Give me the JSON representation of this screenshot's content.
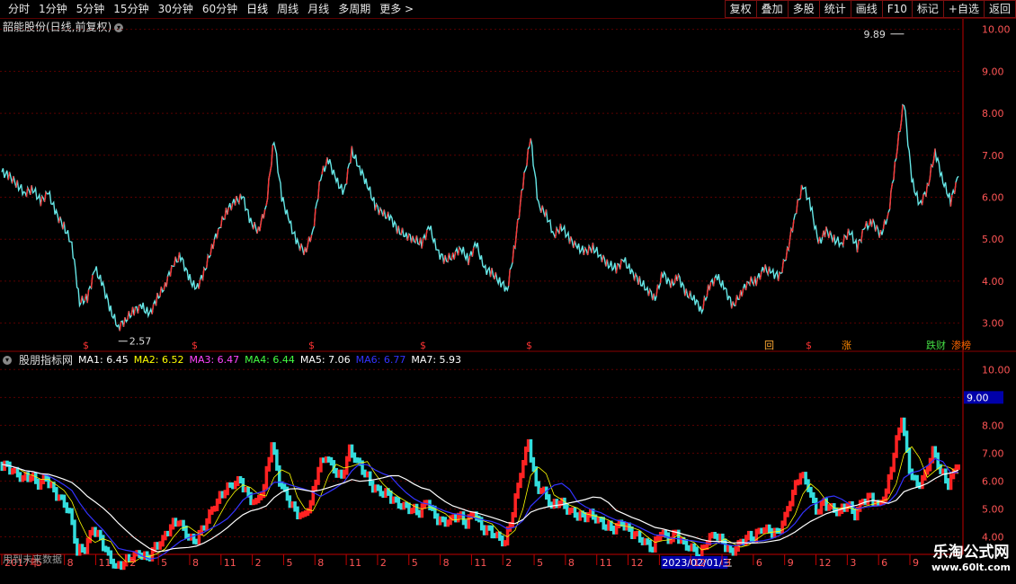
{
  "toolbar": {
    "left": [
      "分时",
      "1分钟",
      "5分钟",
      "15分钟",
      "30分钟",
      "60分钟",
      "日线",
      "周线",
      "月线",
      "多周期",
      "更多 >"
    ],
    "active": "日线",
    "right": [
      "复权",
      "叠加",
      "多股",
      "统计",
      "画线",
      "F10",
      "标记",
      "+自选",
      "返回"
    ]
  },
  "main_title": "韶能股份(日线,前复权)",
  "indicator": {
    "name": "股朋指标网",
    "ma": [
      {
        "label": "MA1:",
        "value": "6.45",
        "color": "#ffffff"
      },
      {
        "label": "MA2:",
        "value": "6.52",
        "color": "#ffff00"
      },
      {
        "label": "MA3:",
        "value": "6.47",
        "color": "#ff44ff"
      },
      {
        "label": "MA4:",
        "value": "6.44",
        "color": "#44ff44"
      },
      {
        "label": "MA5:",
        "value": "7.06",
        "color": "#ffffff"
      },
      {
        "label": "MA6:",
        "value": "6.77",
        "color": "#3333ff"
      },
      {
        "label": "MA7:",
        "value": "5.93",
        "color": "#ffffff"
      }
    ],
    "current_price_tag": "9.00",
    "future_note": "用到未来数据"
  },
  "chart_data": [
    {
      "type": "line",
      "title": "韶能股份(日线,前复权)",
      "y_ticks": [
        "3.00",
        "4.00",
        "5.00",
        "6.00",
        "7.00",
        "8.00",
        "9.00",
        "10.00"
      ],
      "ylim": [
        2.5,
        10.1
      ],
      "annotations": [
        {
          "text": "9.89",
          "value": 9.89
        },
        {
          "text": "2.57",
          "value": 2.57
        }
      ],
      "signal_markers": [
        "$",
        "$",
        "$",
        "$",
        "$",
        "回",
        "$",
        "涨",
        "跌财",
        "渗榜"
      ],
      "series": [
        {
          "values": [
            6.6,
            6.5,
            6.3,
            6.1,
            6.2,
            5.9,
            6.1,
            5.6,
            5.3,
            4.9,
            3.5,
            3.6,
            4.3,
            3.9,
            3.3,
            2.9,
            3.1,
            3.3,
            3.4,
            3.2,
            3.6,
            3.9,
            4.4,
            4.6,
            4.1,
            3.8,
            4.2,
            4.8,
            5.3,
            5.7,
            5.9,
            6.0,
            5.4,
            5.2,
            5.8,
            7.4,
            6.0,
            5.4,
            4.9,
            4.7,
            5.2,
            6.5,
            6.9,
            6.4,
            6.1,
            7.1,
            6.7,
            6.3,
            5.8,
            5.6,
            5.5,
            5.2,
            5.1,
            5.0,
            4.9,
            5.3,
            4.7,
            4.5,
            4.6,
            4.8,
            4.5,
            4.9,
            4.3,
            4.2,
            4.0,
            3.8,
            4.9,
            6.3,
            7.4,
            5.8,
            5.6,
            5.1,
            5.3,
            5.0,
            4.8,
            4.7,
            4.8,
            4.6,
            4.4,
            4.3,
            4.5,
            4.2,
            4.0,
            3.8,
            3.6,
            4.2,
            3.9,
            4.1,
            3.7,
            3.6,
            3.3,
            3.9,
            4.1,
            3.8,
            3.4,
            3.7,
            4.0,
            4.0,
            4.3,
            4.2,
            4.1,
            4.7,
            5.6,
            6.3,
            5.8,
            4.9,
            5.2,
            5.0,
            4.9,
            5.2,
            4.8,
            5.3,
            5.4,
            5.1,
            5.6,
            7.0,
            8.3,
            6.4,
            5.8,
            6.2,
            7.1,
            6.4,
            5.9,
            6.5
          ]
        }
      ]
    },
    {
      "type": "line",
      "title": "股朋指标网",
      "y_ticks": [
        "4.00",
        "5.00",
        "6.00",
        "7.00",
        "8.00",
        "9.00",
        "10.00"
      ],
      "ylim": [
        3.5,
        10.3
      ],
      "x_ticks": [
        "2017年",
        "5",
        "8",
        "11",
        "2",
        "5",
        "8",
        "11",
        "2",
        "5",
        "8",
        "11",
        "2",
        "5",
        "8",
        "11",
        "2",
        "5",
        "8",
        "11",
        "12",
        "2023/02/01/三",
        "12",
        "3",
        "6",
        "9",
        "12",
        "3",
        "6",
        "9"
      ]
    }
  ],
  "watermark": {
    "line1": "乐淘公式网",
    "line2": "www.60lt.com"
  }
}
